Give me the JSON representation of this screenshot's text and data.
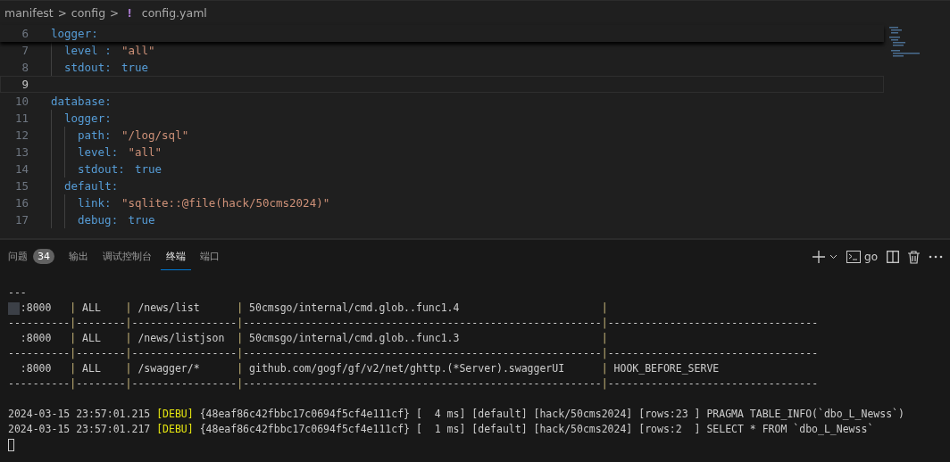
{
  "breadcrumb": [
    "manifest",
    "config"
  ],
  "breadcrumb_separator": ">",
  "file": {
    "icon": "!",
    "name": "config.yaml"
  },
  "editor": {
    "lines": [
      {
        "number": "6",
        "key": "logger:",
        "sticky": true,
        "children": [
          {
            "number": "7",
            "key": "level :",
            "value": "\"all\"",
            "kind": "string"
          },
          {
            "number": "8",
            "key": "stdout:",
            "value": "true",
            "kind": "bool"
          }
        ]
      },
      {
        "number": "9",
        "current": true
      },
      {
        "number": "10",
        "key": "database:",
        "children": [
          {
            "number": "11",
            "key": "logger:",
            "children": [
              {
                "number": "12",
                "key": "path:",
                "value": "\"/log/sql\"",
                "kind": "string"
              },
              {
                "number": "13",
                "key": "level:",
                "value": "\"all\"",
                "kind": "string"
              },
              {
                "number": "14",
                "key": "stdout:",
                "value": "true",
                "kind": "bool"
              }
            ]
          },
          {
            "number": "15",
            "key": "default:",
            "children": [
              {
                "number": "16",
                "key": "link:",
                "value": "\"sqlite::@file(hack/50cms2024)\"",
                "kind": "string"
              },
              {
                "number": "17",
                "key": "debug:",
                "value": "true",
                "kind": "bool"
              }
            ]
          }
        ]
      }
    ]
  },
  "panel_tabs": [
    {
      "label": "问题",
      "badge": "34",
      "selected": false
    },
    {
      "label": "输出",
      "selected": false
    },
    {
      "label": "调试控制台",
      "selected": false
    },
    {
      "label": "终端",
      "selected": true
    },
    {
      "label": "端口",
      "selected": false
    }
  ],
  "terminal_name": "go",
  "terminal_divider": "|",
  "terminal": [
    {
      "kind": "plain",
      "text": "---"
    },
    {
      "kind": "row",
      "cursor": true,
      "cells": [
        ":8000",
        "ALL",
        "/news/list",
        "50cmsgo/internal/cmd.glob..func1.4"
      ]
    },
    {
      "kind": "rule",
      "text": "----------|--------|-----------------|----------------------------------------------------------|----------------------------------"
    },
    {
      "kind": "row",
      "cursor": false,
      "cells": [
        ":8000",
        "ALL",
        "/news/listjson",
        "50cmsgo/internal/cmd.glob..func1.3"
      ]
    },
    {
      "kind": "rule",
      "text": "----------|--------|-----------------|----------------------------------------------------------|----------------------------------"
    },
    {
      "kind": "row",
      "cursor": false,
      "cells": [
        ":8000",
        "ALL",
        "/swagger/*",
        "github.com/gogf/gf/v2/net/ghttp.(*Server).swaggerUI",
        "HOOK_BEFORE_SERVE"
      ]
    },
    {
      "kind": "rule",
      "text": "----------|--------|-----------------|----------------------------------------------------------|----------------------------------"
    },
    {
      "kind": "blank"
    },
    {
      "kind": "log",
      "time": "2024-03-15 23:57:01.215",
      "level": "[DEBU]",
      "message": "{48eaf86c42fbbc17c0694f5cf4e111cf} [  4 ms] [default] [hack/50cms2024] [rows:23 ] PRAGMA TABLE_INFO(`dbo_L_Newss`)"
    },
    {
      "kind": "log",
      "time": "2024-03-15 23:57:01.217",
      "level": "[DEBU]",
      "message": "{48eaf86c42fbbc17c0694f5cf4e111cf} [  1 ms] [default] [hack/50cms2024] [rows:2  ] SELECT * FROM `dbo_L_Newss`"
    },
    {
      "kind": "prompt"
    }
  ]
}
